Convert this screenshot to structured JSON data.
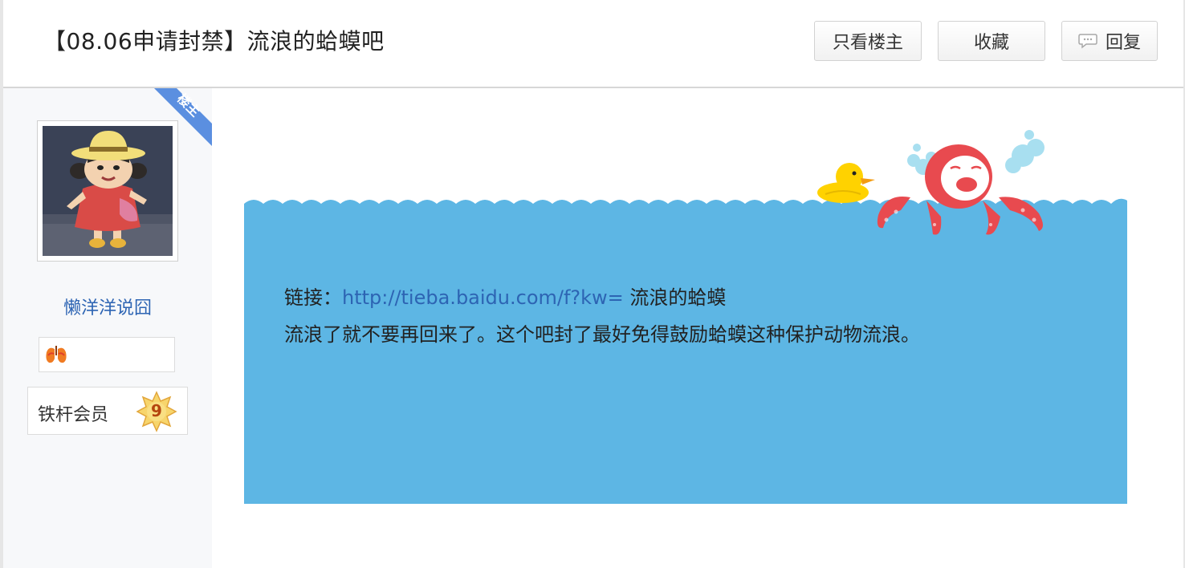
{
  "header": {
    "title": "【08.06申请封禁】流浪的蛤蟆吧",
    "buttons": {
      "only_op": "只看楼主",
      "favorite": "收藏",
      "reply": "回复"
    }
  },
  "author": {
    "op_tag": "楼主",
    "username": "懒洋洋说囧",
    "member_label": "铁杆会员",
    "member_level": "9"
  },
  "post": {
    "link_prefix": "链接：",
    "link_url": "http://tieba.baidu.com/f?kw=",
    "link_suffix": " 流浪的蛤蟆",
    "body": "流浪了就不要再回来了。这个吧封了最好免得鼓励蛤蟆这种保护动物流浪。"
  },
  "colors": {
    "accent_link": "#2d64b3",
    "water": "#5db6e4",
    "op_ribbon": "#5b8fe0",
    "octopus": "#e84a4f",
    "duck": "#ffd200"
  }
}
